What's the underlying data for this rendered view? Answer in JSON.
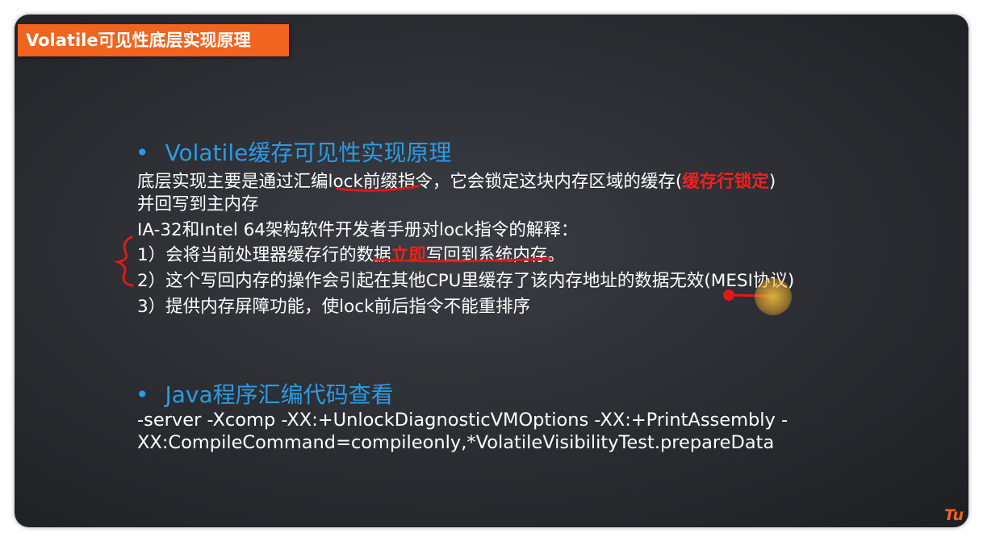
{
  "slide": {
    "title": "Volatile可见性底层实现原理",
    "section1": {
      "bullet": "•",
      "heading": "Volatile缓存可见性实现原理",
      "line1_a": "底层实现主要是通过汇编lock前缀指令，它会锁定这块内存区域的缓存(",
      "line1_red": "缓存行锁定",
      "line1_b": ")",
      "line2": "并回写到主内存",
      "line3": "IA-32和Intel 64架构软件开发者手册对lock指令的解释：",
      "item1_a": "1）会将当前处理器缓存行的数据",
      "item1_red": "立即",
      "item1_b": "写回到系统内存。",
      "item2": "2）这个写回内存的操作会引起在其他CPU里缓存了该内存地址的数据无效(MESI协议)",
      "item3": "3）提供内存屏障功能，使lock前后指令不能重排序"
    },
    "section2": {
      "bullet": "•",
      "heading": "Java程序汇编代码查看",
      "code1": "-server -Xcomp -XX:+UnlockDiagnosticVMOptions -XX:+PrintAssembly -",
      "code2": "XX:CompileCommand=compileonly,*VolatileVisibilityTest.prepareData"
    },
    "logo": "Tu",
    "colors": {
      "accent": "#f0641f",
      "heading": "#2b9be3",
      "highlight": "#f02020",
      "background": "#2c2e33"
    }
  }
}
